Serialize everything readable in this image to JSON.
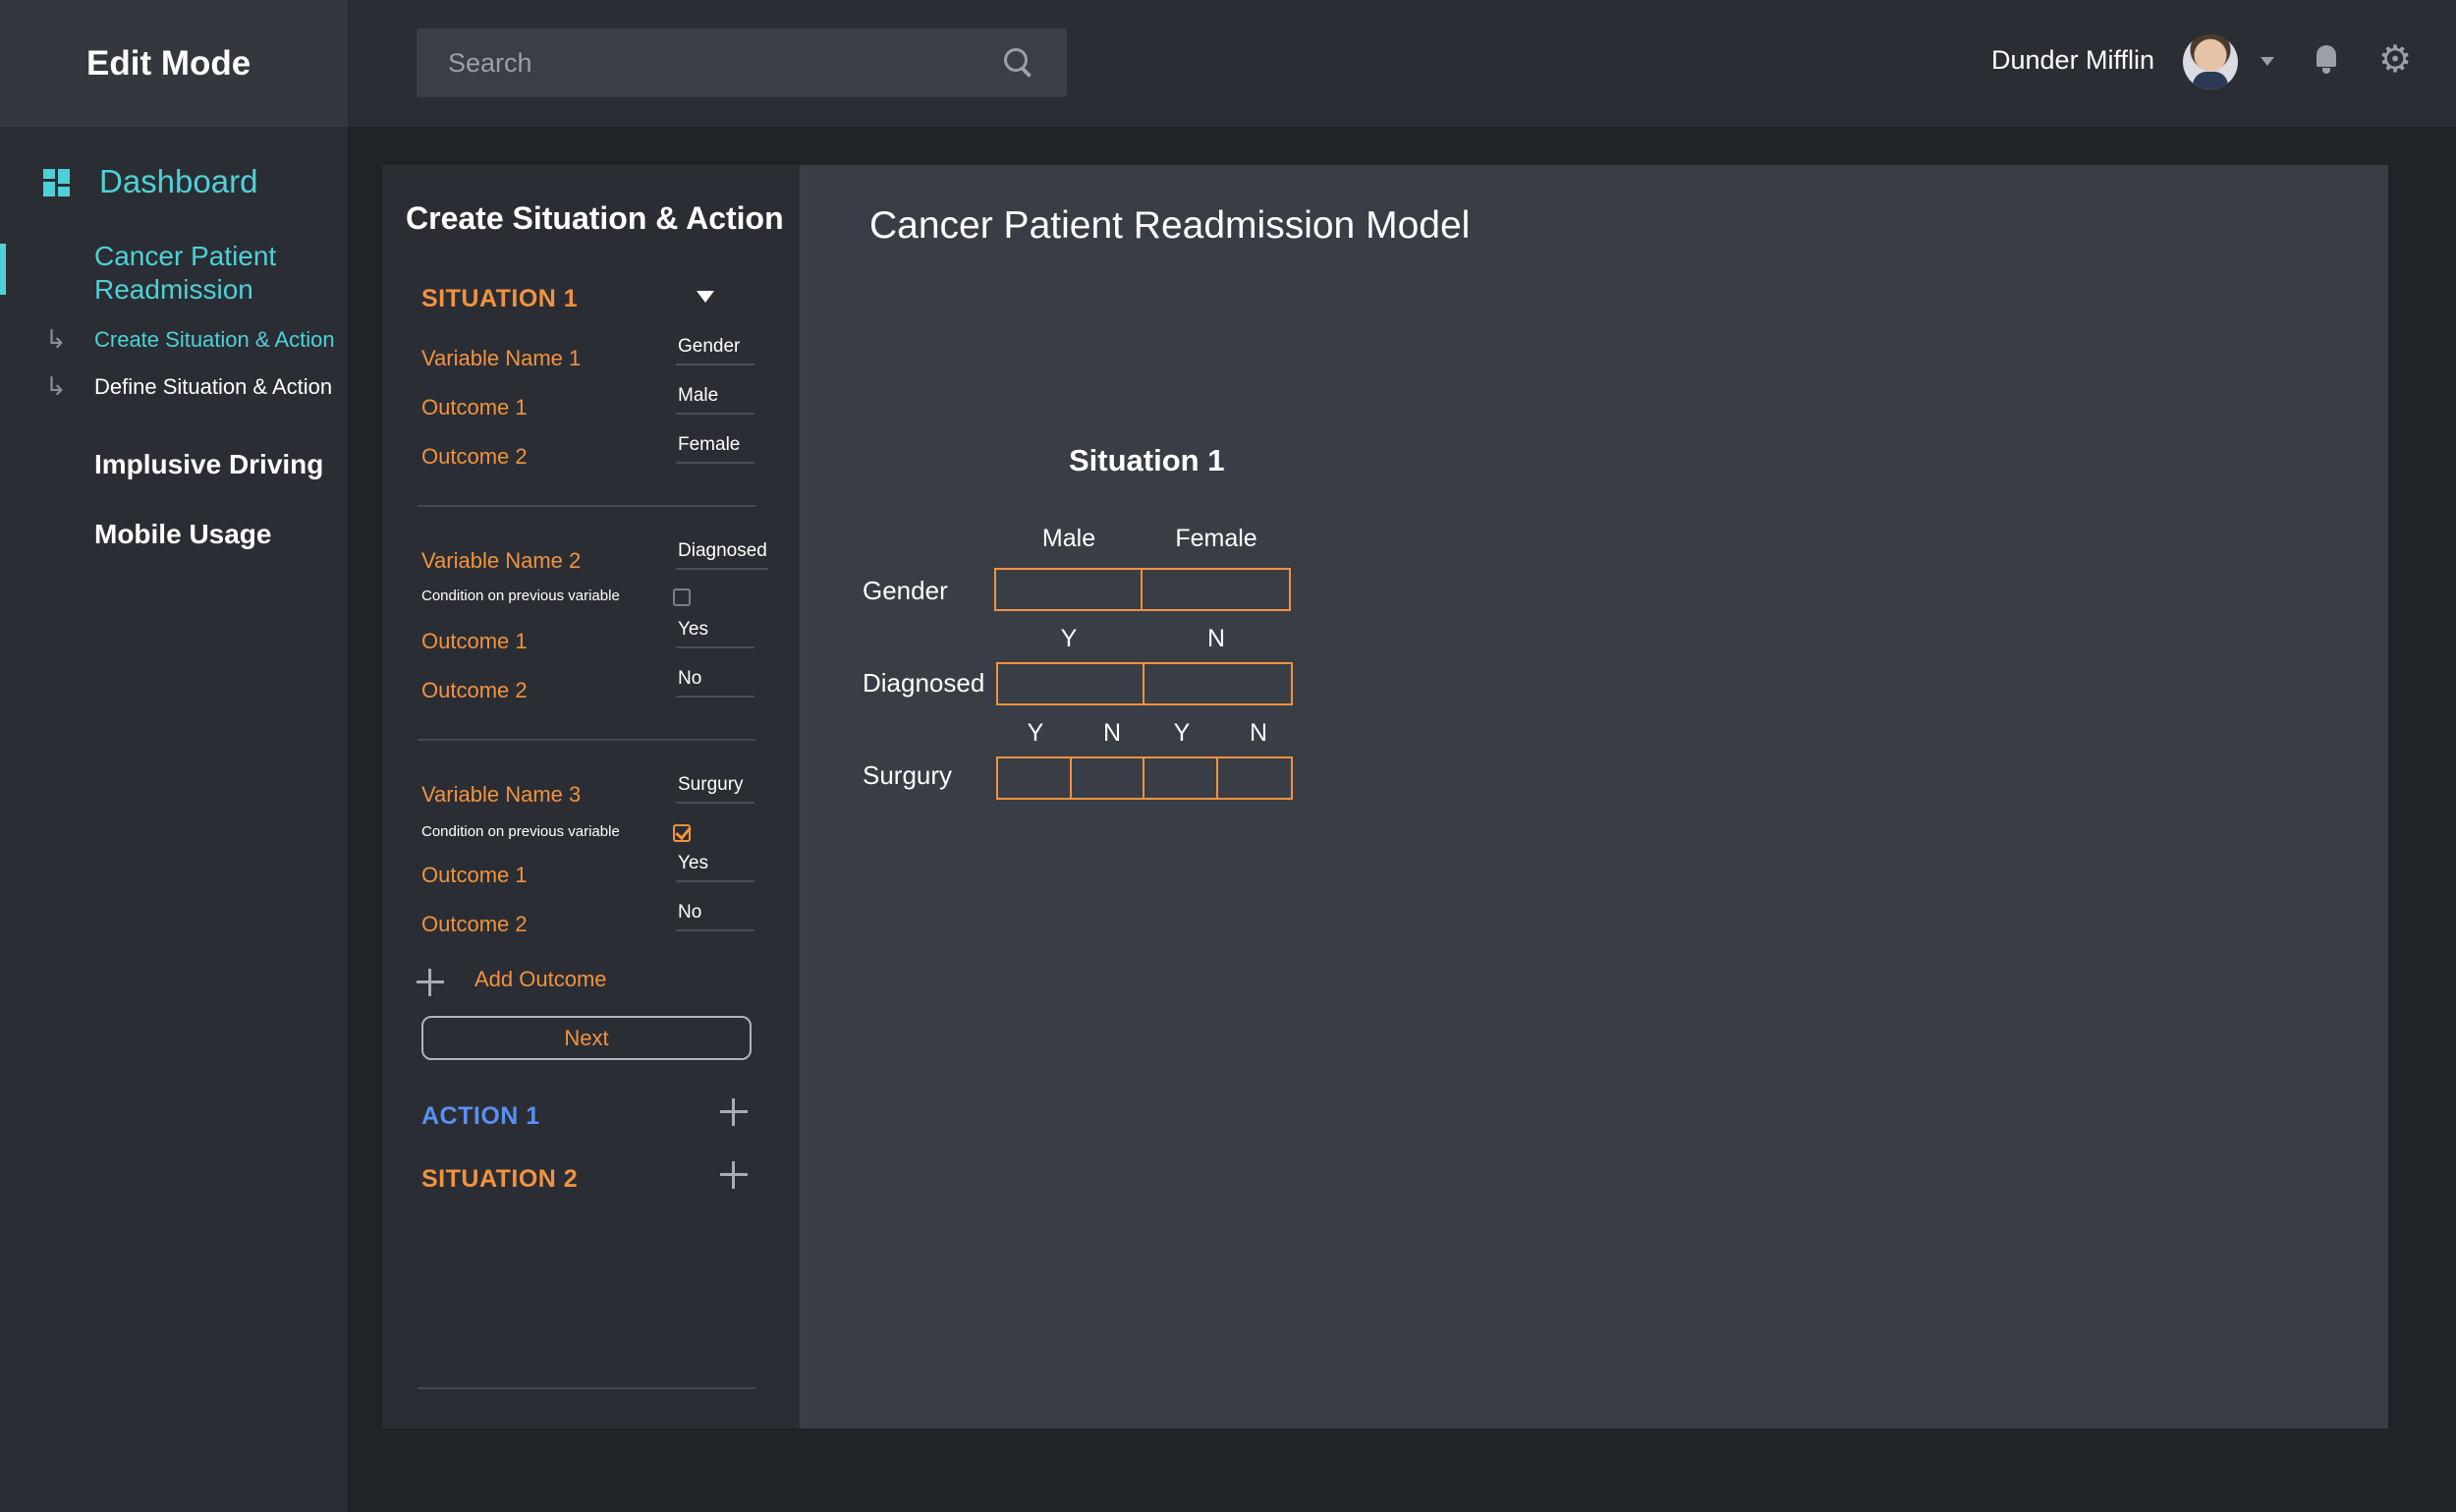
{
  "app": {
    "mode_title": "Edit Mode"
  },
  "sidebar": {
    "dashboard_label": "Dashboard",
    "project_label": "Cancer Patient Readmission",
    "sub_items": [
      "Create Situation & Action",
      "Define Situation & Action"
    ],
    "groups": [
      "Implusive Driving",
      "Mobile Usage"
    ]
  },
  "header": {
    "search_placeholder": "Search",
    "user_name": "Dunder Mifflin"
  },
  "form": {
    "title": "Create Situation & Action",
    "situation_1": "SITUATION 1",
    "variables": [
      {
        "name_label": "Variable Name 1",
        "name_value": "Gender",
        "outcomes": [
          {
            "label": "Outcome 1",
            "value": "Male"
          },
          {
            "label": "Outcome 2",
            "value": "Female"
          }
        ]
      },
      {
        "name_label": "Variable Name 2",
        "name_value": "Diagnosed",
        "condition_label": "Condition on previous variable",
        "condition_checked": false,
        "outcomes": [
          {
            "label": "Outcome 1",
            "value": "Yes"
          },
          {
            "label": "Outcome 2",
            "value": "No"
          }
        ]
      },
      {
        "name_label": "Variable Name 3",
        "name_value": "Surgury",
        "condition_label": "Condition on previous variable",
        "condition_checked": true,
        "outcomes": [
          {
            "label": "Outcome 1",
            "value": "Yes"
          },
          {
            "label": "Outcome 2",
            "value": "No"
          }
        ]
      }
    ],
    "add_outcome_label": "Add Outcome",
    "next_label": "Next",
    "action_1": "ACTION 1",
    "situation_2": "SITUATION 2"
  },
  "model": {
    "title": "Cancer Patient Readmission Model",
    "situation_title": "Situation 1",
    "rows": [
      {
        "label": "Gender",
        "headers": [
          "Male",
          "Female"
        ],
        "cells": 2
      },
      {
        "label": "Diagnosed",
        "headers": [
          "Y",
          "N"
        ],
        "cells": 2
      },
      {
        "label": "Surgury",
        "headers": [
          "Y",
          "N",
          "Y",
          "N"
        ],
        "cells": 4
      }
    ]
  },
  "colors": {
    "accent": "#4fd0d6",
    "orange": "#f2923f",
    "blue": "#5b8ff0"
  }
}
